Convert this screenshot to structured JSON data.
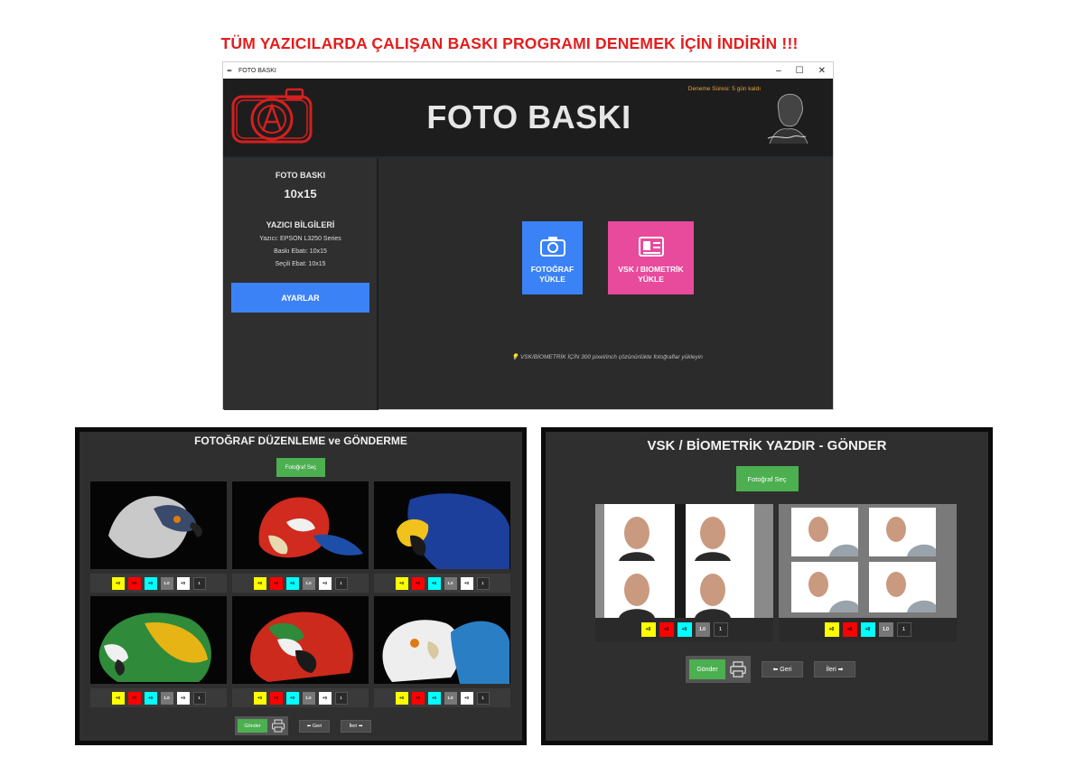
{
  "banner": "TÜM YAZICILARDA ÇALIŞAN BASKI PROGRAMI DENEMEK İÇİN İNDİRİN !!!",
  "window": {
    "title": "FOTO BASKI",
    "app_title": "FOTO BASKI",
    "trial": "Deneme Süresi: 5 gün kaldı"
  },
  "sidebar": {
    "title": "FOTO BASKI",
    "size": "10x15",
    "printer_heading": "YAZICI BİLGİLERİ",
    "printer": "Yazıcı: EPSON L3250 Series",
    "print_size": "Baskı Ebatı: 10x15",
    "selected_size": "Seçili Ebat: 10x15",
    "settings_button": "AYARLAR"
  },
  "main": {
    "photo_tile_line1": "FOTOĞRAF",
    "photo_tile_line2": "YÜKLE",
    "vsk_tile_line1": "VSK / BIOMETRİK",
    "vsk_tile_line2": "YÜKLE",
    "hint": "💡 VSK/BİOMETRİK İÇİN 300 pixel/inch çözünürlükte fotoğraflar yükleyin"
  },
  "left_panel": {
    "title": "FOTOĞRAF DÜZENLEME ve GÖNDERME",
    "choose_button": "Fotoğraf Seç",
    "adjust": [
      "+0",
      "+0",
      "+0",
      "1.0",
      "+0",
      "1"
    ],
    "send_button": "Gönder",
    "back_button": "⬅ Geri",
    "next_button": "İleri ➡"
  },
  "right_panel": {
    "title": "VSK / BİOMETRİK YAZDIR - GÖNDER",
    "choose_button": "Fotoğraf Seç",
    "adjust": [
      "+0",
      "+0",
      "+0",
      "1.0",
      "1"
    ],
    "send_button": "Gönder",
    "back_button": "⬅ Geri",
    "next_button": "İleri ➡"
  },
  "colors": {
    "banner": "#e41d1d",
    "settings": "#3b82f6",
    "photo_tile": "#3b82f6",
    "vsk_tile": "#e84a9c",
    "green": "#4caf50",
    "trial": "#e8a23a"
  }
}
